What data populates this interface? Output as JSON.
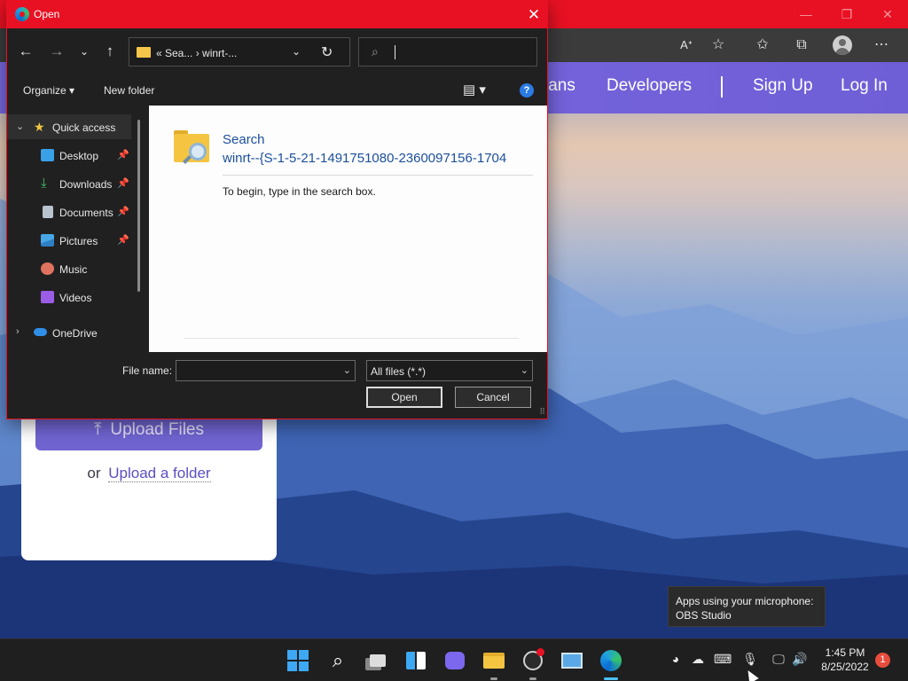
{
  "browser": {
    "nav_links": [
      "lans",
      "Developers",
      "Sign Up",
      "Log In"
    ],
    "toolbar_icons": [
      "read-aloud-icon",
      "add-favorite-icon",
      "favorites-icon",
      "collections-icon",
      "profile-icon",
      "more-icon"
    ]
  },
  "upload_card": {
    "upload_label": "Upload Files",
    "or_text": "or",
    "folder_link": "Upload a folder"
  },
  "dialog": {
    "title": "Open",
    "address": {
      "breadcrumb": "«  Sea...  ›  winrt-..."
    },
    "search_placeholder": "",
    "commands": {
      "organize": "Organize ▾",
      "new_folder": "New folder",
      "help": "?"
    },
    "nav_items": [
      {
        "label": "Quick access",
        "icon": "star-icon",
        "color": "#f5c542"
      },
      {
        "label": "Desktop",
        "icon": "desktop-icon",
        "color": "#3aa0e8",
        "pinned": true
      },
      {
        "label": "Downloads",
        "icon": "download-icon",
        "color": "#3ec46d",
        "pinned": true
      },
      {
        "label": "Documents",
        "icon": "documents-icon",
        "color": "#b9c3cf",
        "pinned": true
      },
      {
        "label": "Pictures",
        "icon": "pictures-icon",
        "color": "#48a6e6",
        "pinned": true
      },
      {
        "label": "Music",
        "icon": "music-icon",
        "color": "#e0735f"
      },
      {
        "label": "Videos",
        "icon": "videos-icon",
        "color": "#9b5de5"
      },
      {
        "label": "OneDrive",
        "icon": "onedrive-icon",
        "color": "#2f8ee8"
      }
    ],
    "content": {
      "title_line1": "Search",
      "title_line2": "winrt--{S-1-5-21-1491751080-2360097156-1704",
      "hint": "To begin, type in the search box."
    },
    "file_name_label": "File name:",
    "file_name_value": "",
    "file_type": "All files (*.*)",
    "open_button": "Open",
    "cancel_button": "Cancel"
  },
  "tooltip": {
    "line1": "Apps using your microphone:",
    "line2": "OBS Studio"
  },
  "taskbar": {
    "time": "1:45 PM",
    "date": "8/25/2022",
    "notification_count": "1"
  },
  "colors": {
    "title_red": "#e81123",
    "nav_purple": "#7a67e0",
    "upload_button": "#7064d1",
    "link_blue": "#1c4f9c"
  }
}
